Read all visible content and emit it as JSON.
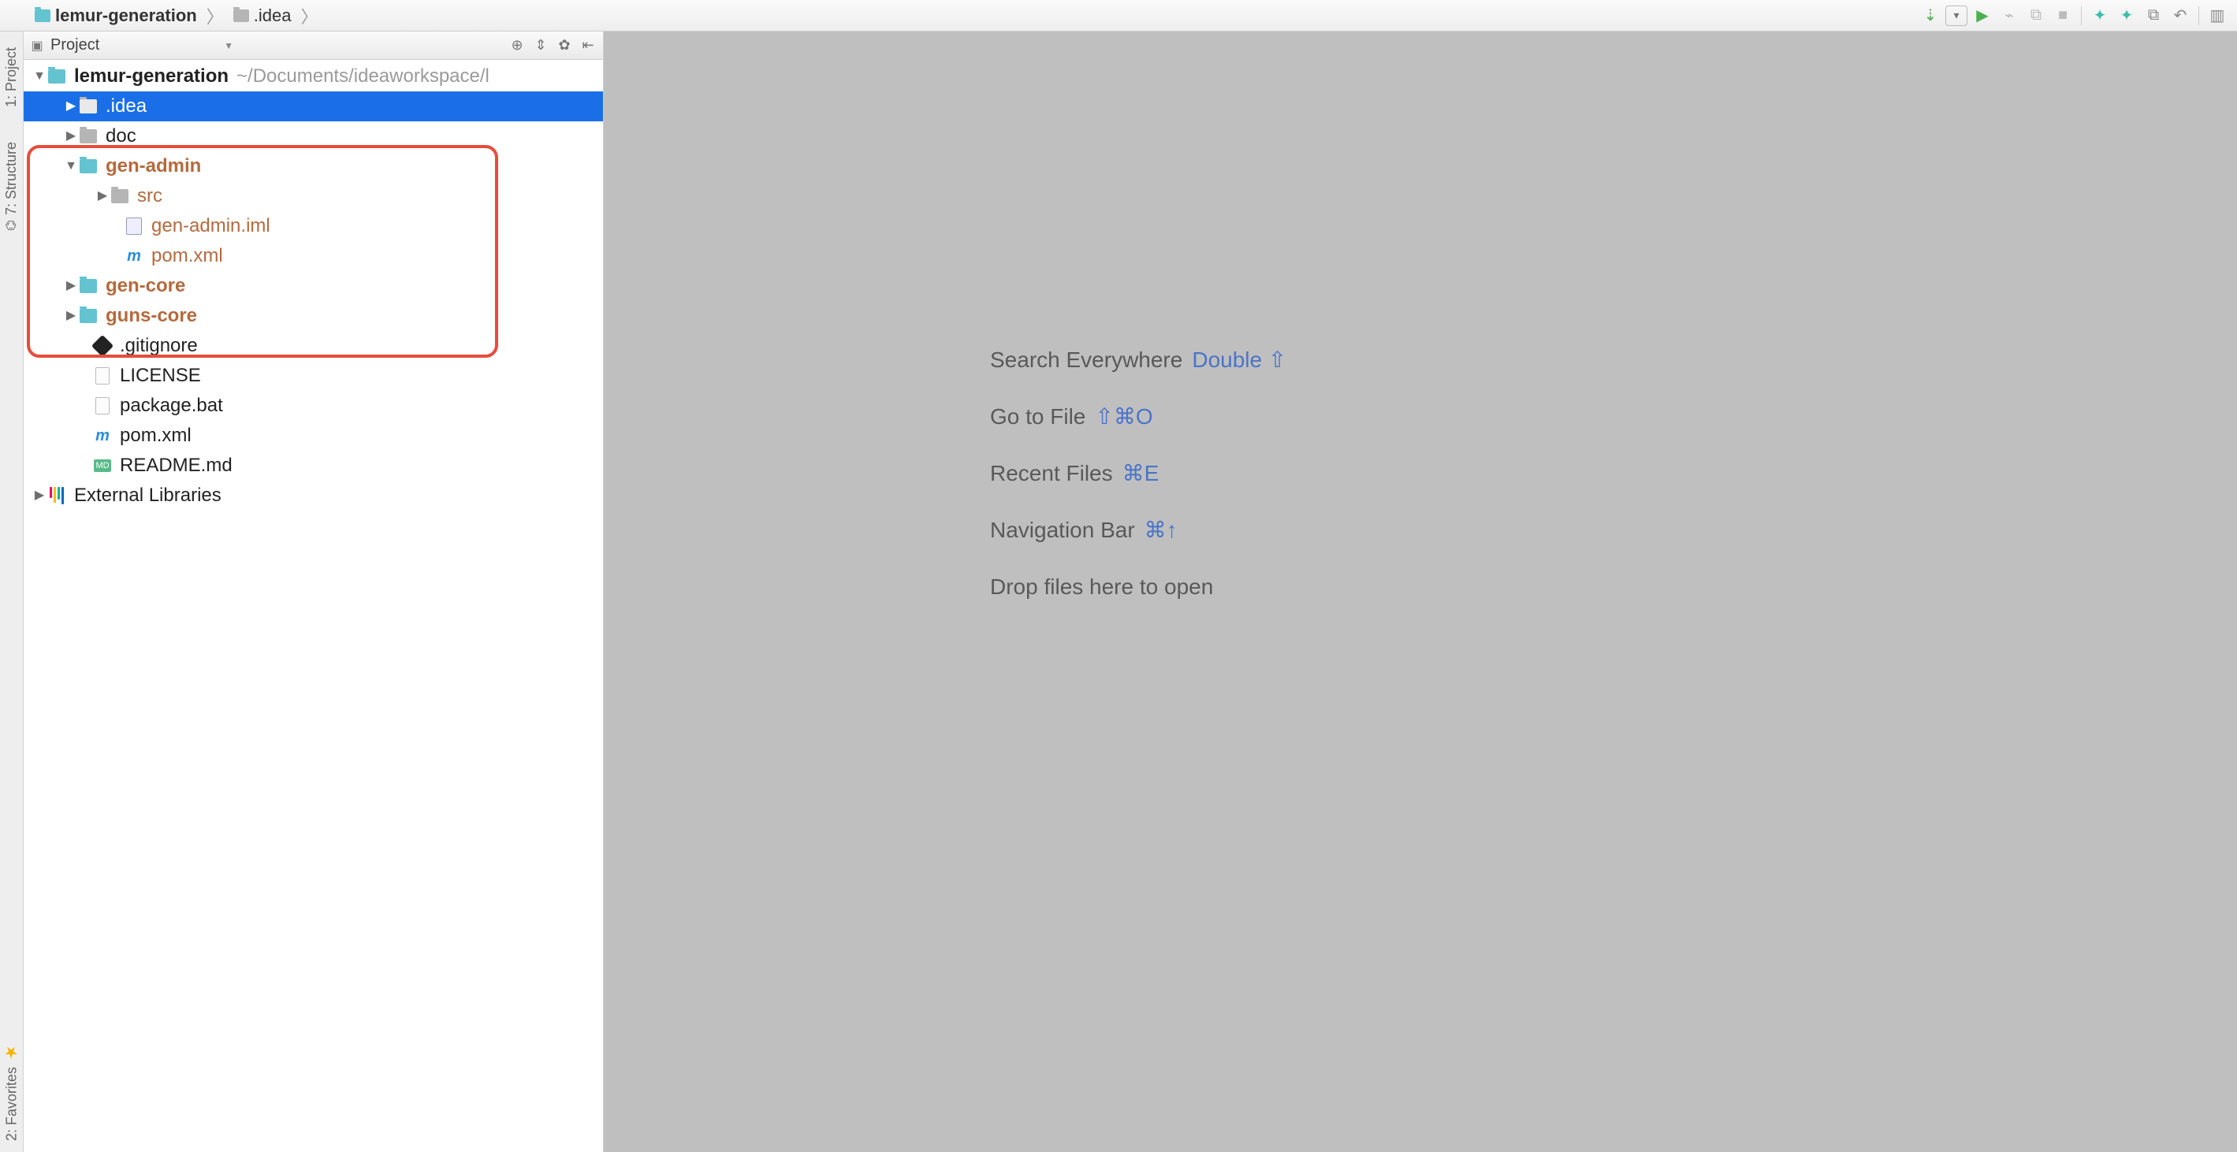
{
  "breadcrumbs": {
    "root": "lemur-generation",
    "child": ".idea"
  },
  "toolbar": {
    "update_icon": "update-from-vcs-icon",
    "run_icon": "run-icon",
    "debug_icon": "debug-icon",
    "coverage_icon": "coverage-icon",
    "stop_icon": "stop-icon",
    "vcs1_icon": "branch-icon",
    "vcs2_icon": "branch-icon",
    "diff_icon": "diff-icon",
    "undo_icon": "undo-icon",
    "structure_icon": "structure-icon"
  },
  "left_tabs": {
    "project": "1: Project",
    "structure": "7: Structure",
    "favorites": "2: Favorites"
  },
  "panel": {
    "title": "Project"
  },
  "tree": {
    "root": {
      "name": "lemur-generation",
      "path": "~/Documents/ideaworkspace/l"
    },
    "idea": ".idea",
    "doc": "doc",
    "gen_admin": "gen-admin",
    "src": "src",
    "gen_admin_iml": "gen-admin.iml",
    "gen_admin_pom": "pom.xml",
    "gen_core": "gen-core",
    "guns_core": "guns-core",
    "gitignore": ".gitignore",
    "license": "LICENSE",
    "package_bat": "package.bat",
    "root_pom": "pom.xml",
    "readme": "README.md",
    "external": "External Libraries"
  },
  "hints": {
    "search": {
      "label": "Search Everywhere",
      "shortcut": "Double ⇧"
    },
    "gotofile": {
      "label": "Go to File",
      "shortcut": "⇧⌘O"
    },
    "recent": {
      "label": "Recent Files",
      "shortcut": "⌘E"
    },
    "navbar": {
      "label": "Navigation Bar",
      "shortcut": "⌘↑"
    },
    "drop": {
      "label": "Drop files here to open"
    }
  }
}
